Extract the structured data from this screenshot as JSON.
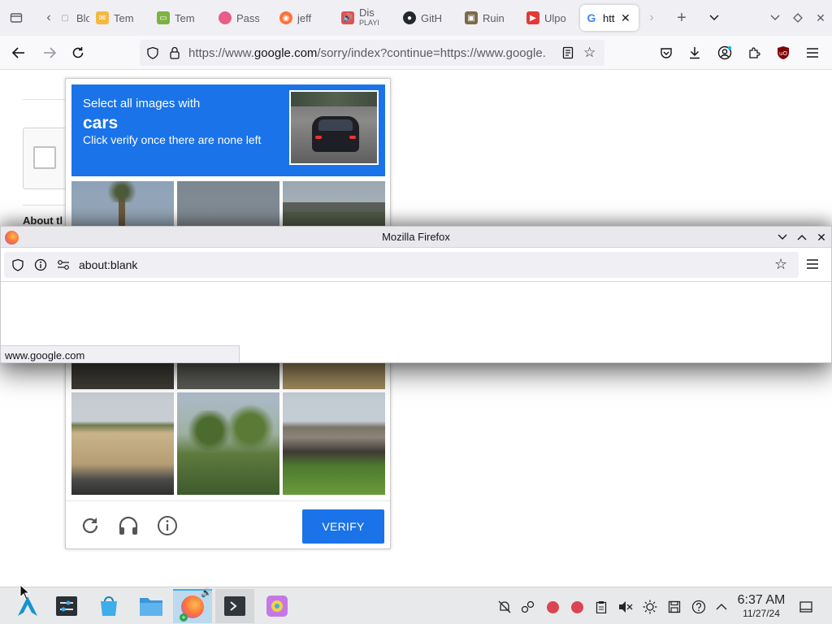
{
  "tabs": [
    {
      "label": "Blo",
      "icon": "blog-favicon-icon",
      "color": "#9a9a9a"
    },
    {
      "label": "Tem",
      "icon": "envelope-favicon-icon",
      "color": "#f5b940"
    },
    {
      "label": "Tem",
      "icon": "temp-favicon-icon",
      "color": "#7cb342"
    },
    {
      "label": "Pass",
      "icon": "pass-favicon-icon",
      "color": "#e85d8a"
    },
    {
      "label": "jeff",
      "icon": "jeff-favicon-icon",
      "color": "#ff7139"
    },
    {
      "label": "Dis",
      "sublabel": "PLAYI",
      "icon": "audio-playing-icon",
      "color": "#e05151"
    },
    {
      "label": "GitH",
      "icon": "github-favicon-icon",
      "color": "#24292f"
    },
    {
      "label": "Ruin",
      "icon": "ruin-favicon-icon",
      "color": "#7a6a4a"
    },
    {
      "label": "Ulpo",
      "icon": "youtube-favicon-icon",
      "color": "#e53935"
    },
    {
      "label": "htt",
      "icon": "google-favicon-icon",
      "color": "#4285f4",
      "active": true
    }
  ],
  "navbar": {
    "url_prefix": "https://www.",
    "url_domain": "google.com",
    "url_suffix": "/sorry/index?continue=https://www.google."
  },
  "page": {
    "about_label": "About tl"
  },
  "captcha": {
    "instruction_line1": "Select all images with",
    "target_object": "cars",
    "instruction_line3": "Click verify once there are none left",
    "verify_label": "VERIFY",
    "colors": {
      "accent": "#1a73e8"
    }
  },
  "popup": {
    "title": "Mozilla Firefox",
    "url": "about:blank",
    "status": "www.google.com"
  },
  "taskbar": {
    "time": "6:37 AM",
    "date": "11/27/24"
  }
}
